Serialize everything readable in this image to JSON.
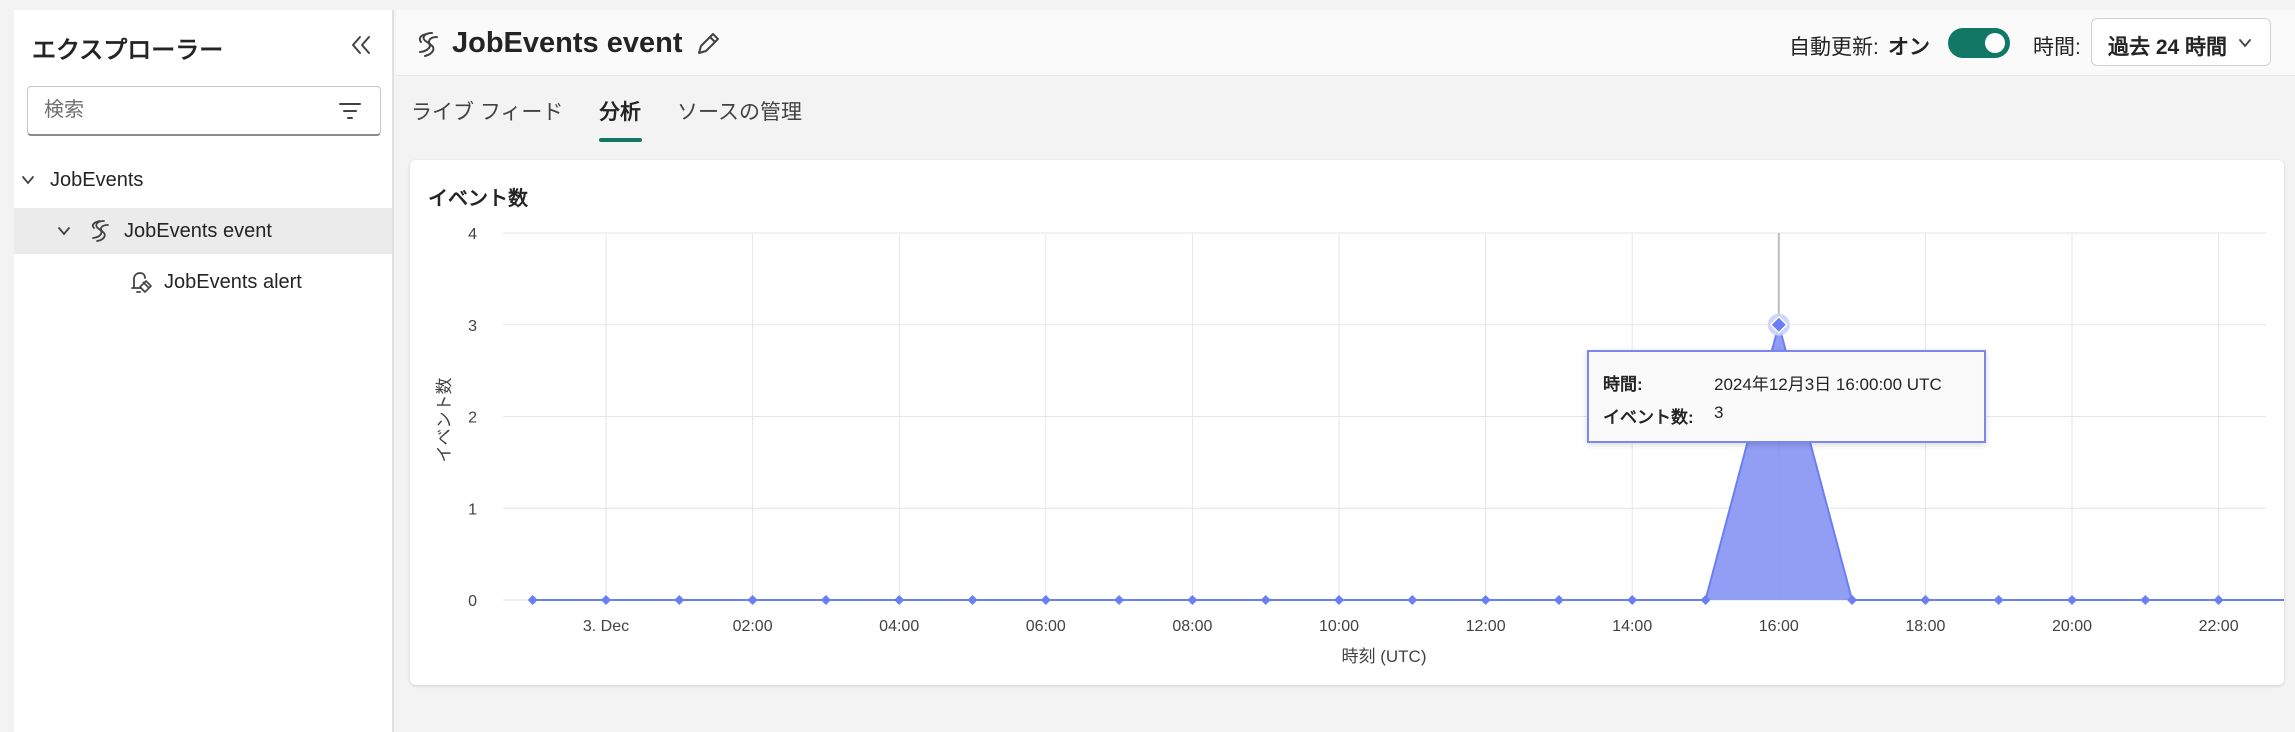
{
  "sidebar": {
    "title": "エクスプローラー",
    "search_placeholder": "検索",
    "tree": [
      {
        "label": "JobEvents"
      },
      {
        "label": "JobEvents event"
      },
      {
        "label": "JobEvents alert"
      }
    ]
  },
  "header": {
    "title": "JobEvents event",
    "auto_refresh_label": "自動更新:",
    "auto_refresh_value": "オン",
    "time_label": "時間:",
    "time_value": "過去 24 時間"
  },
  "tabs": [
    {
      "label": "ライブ フィード"
    },
    {
      "label": "分析",
      "active": true
    },
    {
      "label": "ソースの管理"
    }
  ],
  "colors": {
    "accent": "#117865",
    "series": "#6a7ef5",
    "fill": "#8b99f2"
  },
  "chart_data": {
    "type": "area",
    "title": "イベント数",
    "xlabel": "時刻 (UTC)",
    "ylabel": "イベント数",
    "ylim": [
      0,
      4
    ],
    "yticks": [
      0,
      1,
      2,
      3,
      4
    ],
    "grid": true,
    "x_tick_labels": [
      "3. Dec",
      "02:00",
      "04:00",
      "06:00",
      "08:00",
      "10:00",
      "12:00",
      "14:00",
      "16:00",
      "18:00",
      "20:00",
      "22:00"
    ],
    "x_hours": [
      -1,
      0,
      1,
      2,
      3,
      4,
      5,
      6,
      7,
      8,
      9,
      10,
      11,
      12,
      13,
      14,
      15,
      16,
      17,
      18,
      19,
      20,
      21,
      22,
      23,
      23.55
    ],
    "values": [
      0,
      0,
      0,
      0,
      0,
      0,
      0,
      0,
      0,
      0,
      0,
      0,
      0,
      0,
      0,
      0,
      0,
      3,
      0,
      0,
      0,
      0,
      0,
      0,
      0,
      0.55
    ],
    "highlight_hour": 16
  },
  "tooltip": {
    "time_label": "時間:",
    "time_value": "2024年12月3日 16:00:00 UTC",
    "count_label": "イベント数:",
    "count_value": "3"
  }
}
